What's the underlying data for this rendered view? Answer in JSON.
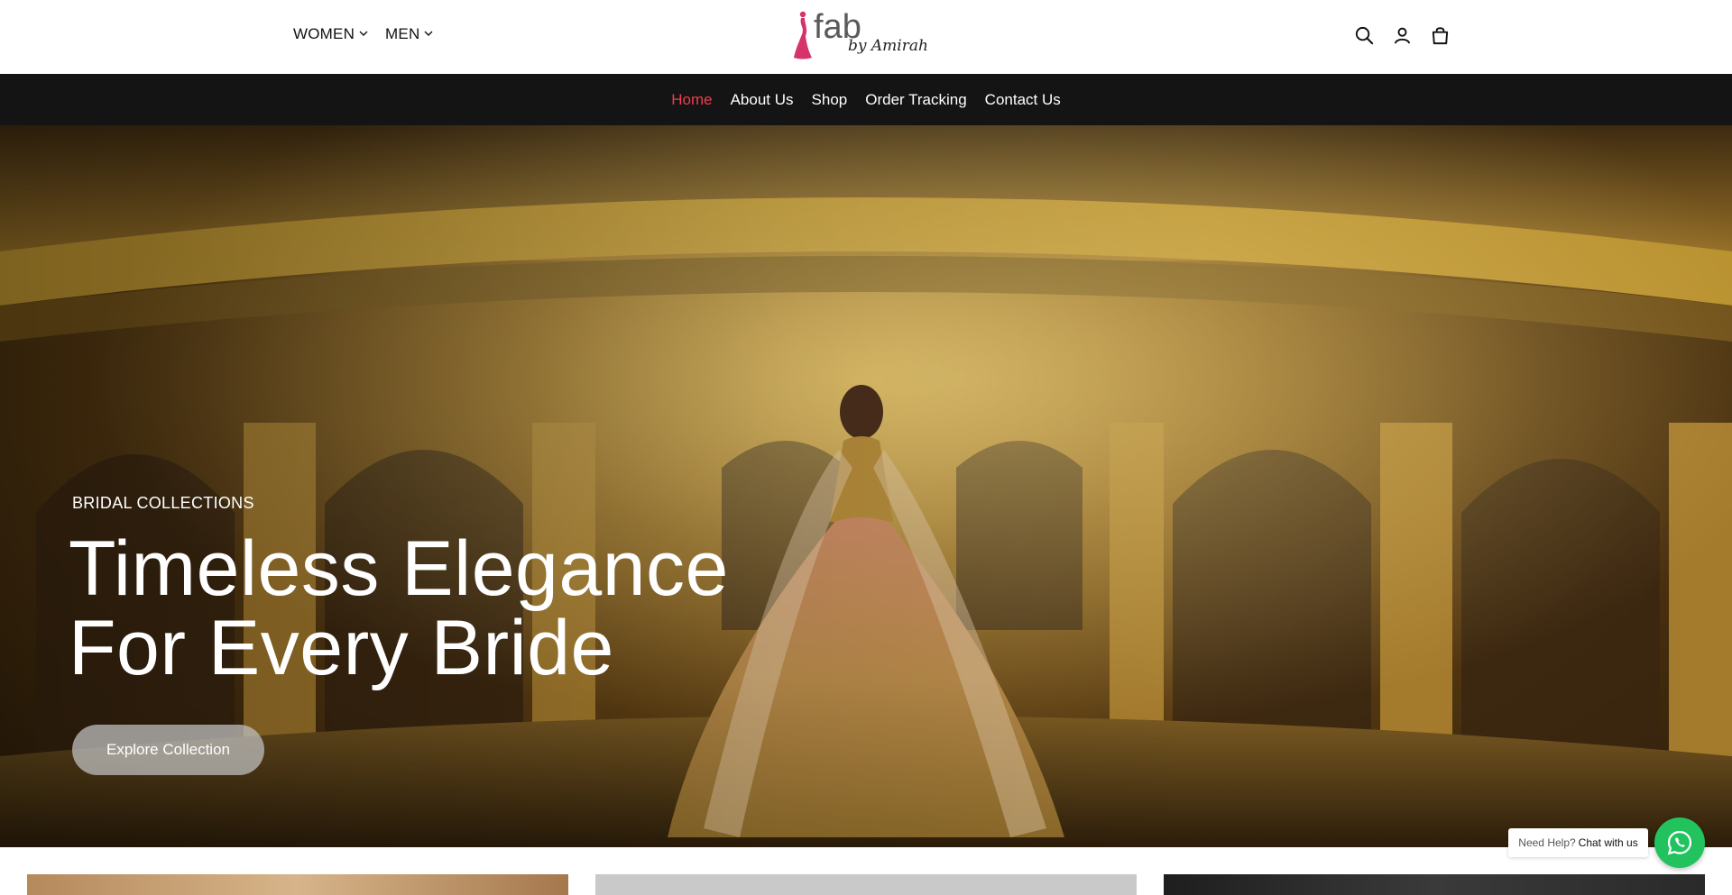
{
  "header": {
    "categories": [
      {
        "label": "WOMEN"
      },
      {
        "label": "MEN"
      }
    ],
    "logo": {
      "main": "fab",
      "sub": "by Amirah"
    },
    "icons": [
      "search-icon",
      "user-icon",
      "shopping-bag-icon"
    ]
  },
  "main_nav": {
    "items": [
      {
        "label": "Home",
        "active": true
      },
      {
        "label": "About Us"
      },
      {
        "label": "Shop"
      },
      {
        "label": "Order Tracking"
      },
      {
        "label": "Contact Us"
      }
    ]
  },
  "hero": {
    "kicker": "BRIDAL COLLECTIONS",
    "title_line1": "Timeless Elegance",
    "title_line2": "For Every Bride",
    "cta": "Explore Collection"
  },
  "chat": {
    "prefix": "Need Help?",
    "link": "Chat with us",
    "icon": "whatsapp-icon",
    "color": "#22c35e"
  },
  "colors": {
    "nav_bg": "#141414",
    "nav_active": "#ef3d4e",
    "brand_pink": "#d6336c"
  }
}
